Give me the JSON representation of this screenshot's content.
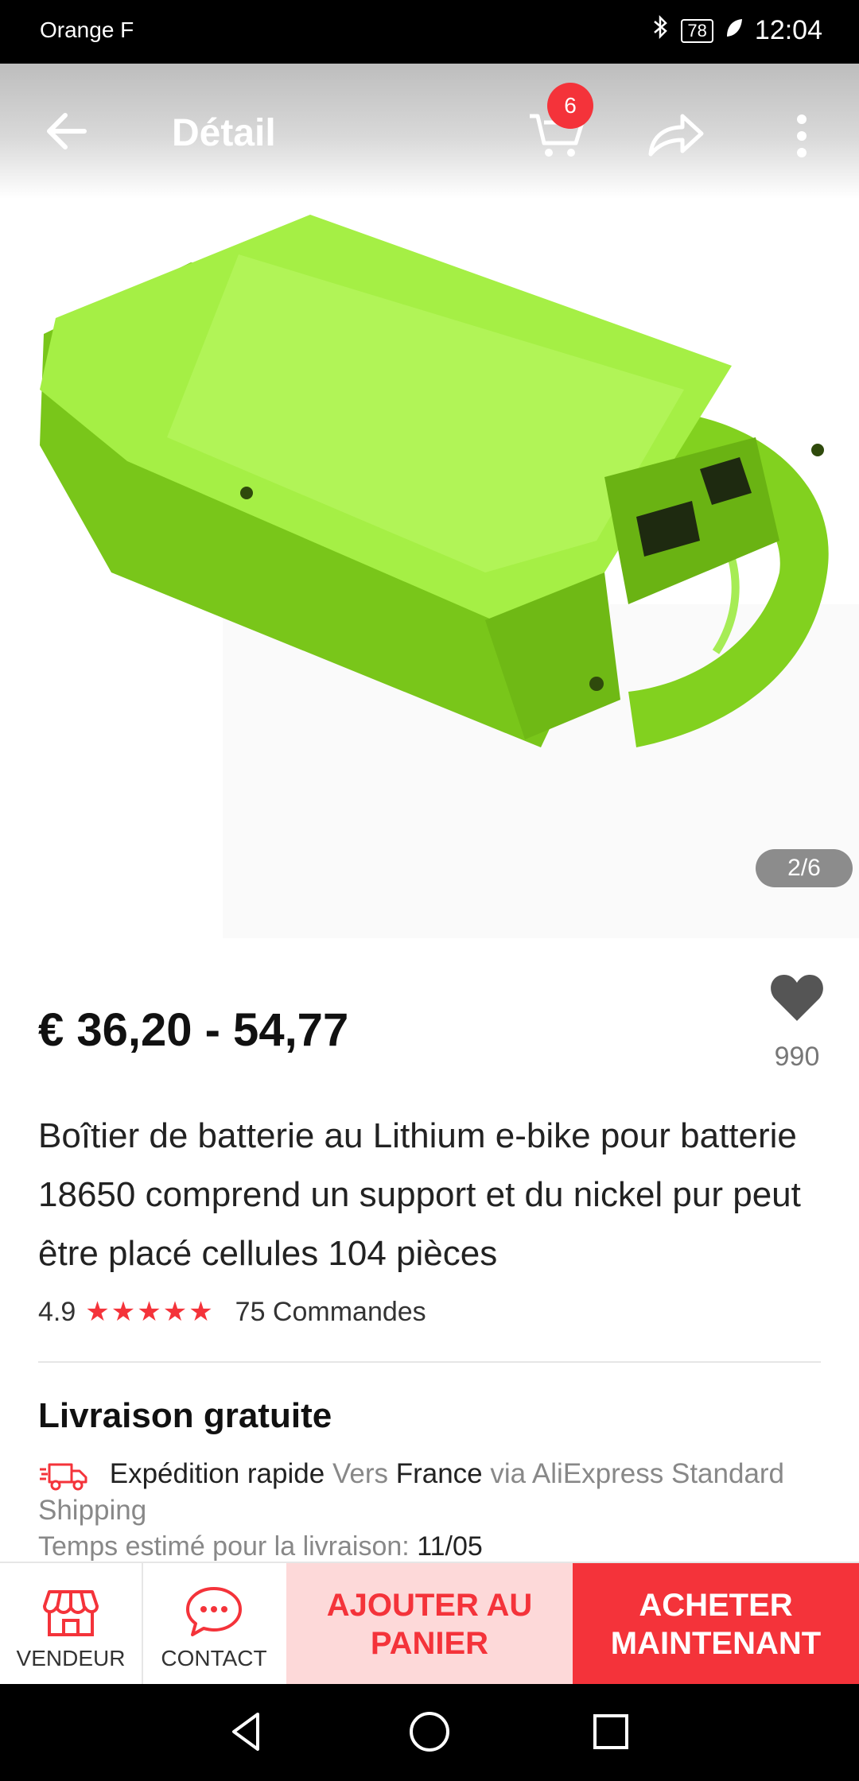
{
  "status": {
    "carrier": "Orange F",
    "battery": "78",
    "time": "12:04"
  },
  "header": {
    "title": "Détail",
    "cart_count": "6"
  },
  "gallery": {
    "pager": "2/6"
  },
  "product": {
    "price": "€ 36,20 - 54,77",
    "wishlist_count": "990",
    "title": "Boîtier de batterie au Lithium e-bike pour batterie 18650 comprend un support et du nickel pur peut être placé cellules 104 pièces",
    "rating": "4.9",
    "stars": "★★★★★",
    "orders": "75 Commandes"
  },
  "shipping": {
    "title": "Livraison gratuite",
    "method": "Expédition rapide",
    "to_label": "Vers",
    "country": "France",
    "via_text": "via AliExpress Standard Shipping",
    "estimate_label": "Temps estimé pour la livraison:",
    "estimate_date": "11/05"
  },
  "bottom_bar": {
    "seller_label": "VENDEUR",
    "contact_label": "CONTACT",
    "add_to_cart": "AJOUTER AU PANIER",
    "buy_now": "ACHETER MAINTENANT"
  },
  "colors": {
    "accent": "#f4333a",
    "product_green": "#8fe02a"
  }
}
